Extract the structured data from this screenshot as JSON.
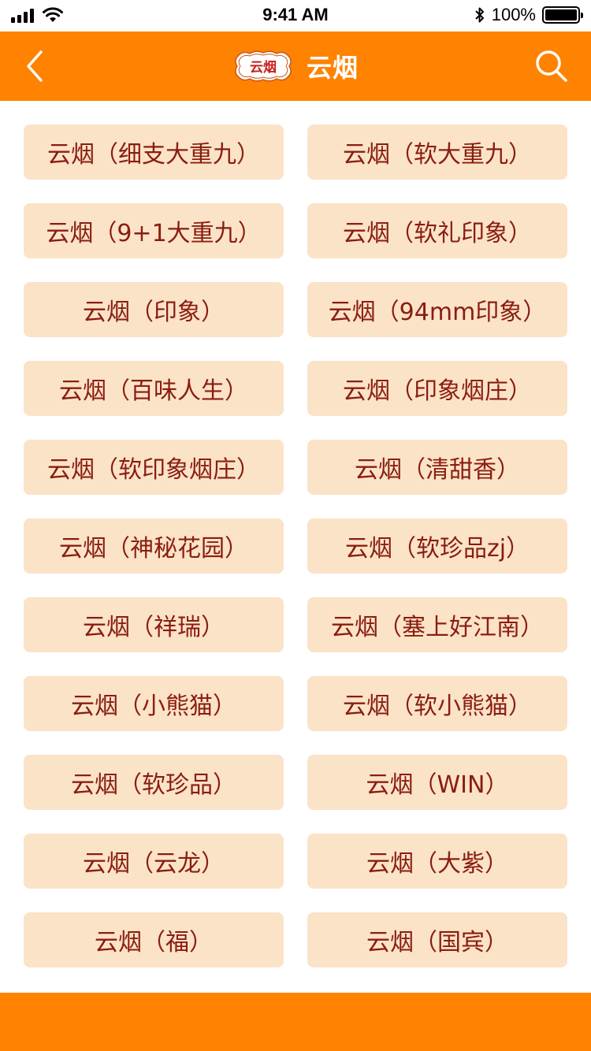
{
  "status_bar": {
    "time": "9:41 AM",
    "battery_text": "100%",
    "battery_level": 1.0
  },
  "nav": {
    "title": "云烟",
    "logo_text": "云烟",
    "back_icon": "chevron-left-icon",
    "search_icon": "search-icon"
  },
  "colors": {
    "brand_orange": "#ff8200",
    "item_bg": "#fbe3c8",
    "item_text": "#8a1d10"
  },
  "products": [
    {
      "label": "云烟（细支大重九）"
    },
    {
      "label": "云烟（软大重九）"
    },
    {
      "label": "云烟（9+1大重九）"
    },
    {
      "label": "云烟（软礼印象）"
    },
    {
      "label": "云烟（印象）"
    },
    {
      "label": "云烟（94mm印象）"
    },
    {
      "label": "云烟（百味人生）"
    },
    {
      "label": "云烟（印象烟庄）"
    },
    {
      "label": "云烟（软印象烟庄）"
    },
    {
      "label": "云烟（清甜香）"
    },
    {
      "label": "云烟（神秘花园）"
    },
    {
      "label": "云烟（软珍品zj）"
    },
    {
      "label": "云烟（祥瑞）"
    },
    {
      "label": "云烟（塞上好江南）"
    },
    {
      "label": "云烟（小熊猫）"
    },
    {
      "label": "云烟（软小熊猫）"
    },
    {
      "label": "云烟（软珍品）"
    },
    {
      "label": "云烟（WIN）"
    },
    {
      "label": "云烟（云龙）"
    },
    {
      "label": "云烟（大紫）"
    },
    {
      "label": "云烟（福）"
    },
    {
      "label": "云烟（国宾）"
    }
  ]
}
